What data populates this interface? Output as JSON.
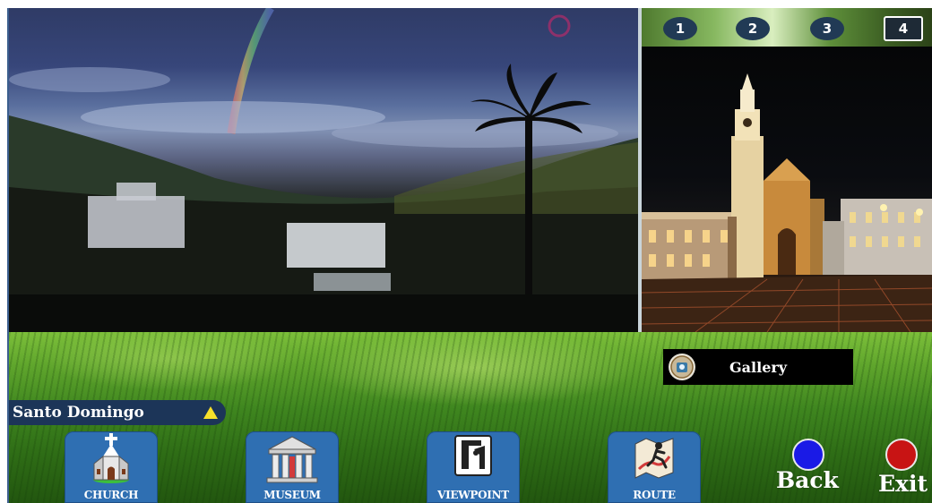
{
  "thumbnails": [
    {
      "label": "1"
    },
    {
      "label": "2"
    },
    {
      "label": "3"
    },
    {
      "label": "4",
      "active": true
    }
  ],
  "gallery": {
    "label": "Gallery",
    "icon": "camera-icon"
  },
  "location": {
    "name": "Santo Domingo",
    "icon": "warning-triangle-icon"
  },
  "nav": [
    {
      "label": "CHURCH",
      "icon": "church-icon"
    },
    {
      "label": "MUSEUM",
      "icon": "museum-icon"
    },
    {
      "label": "VIEWPOINT",
      "icon": "viewpoint-icon"
    },
    {
      "label": "ROUTE",
      "icon": "route-map-icon"
    }
  ],
  "controls": {
    "back": {
      "label": "Back",
      "color": "#1a1ae6"
    },
    "exit": {
      "label": "Exit",
      "color": "#c81414"
    }
  }
}
